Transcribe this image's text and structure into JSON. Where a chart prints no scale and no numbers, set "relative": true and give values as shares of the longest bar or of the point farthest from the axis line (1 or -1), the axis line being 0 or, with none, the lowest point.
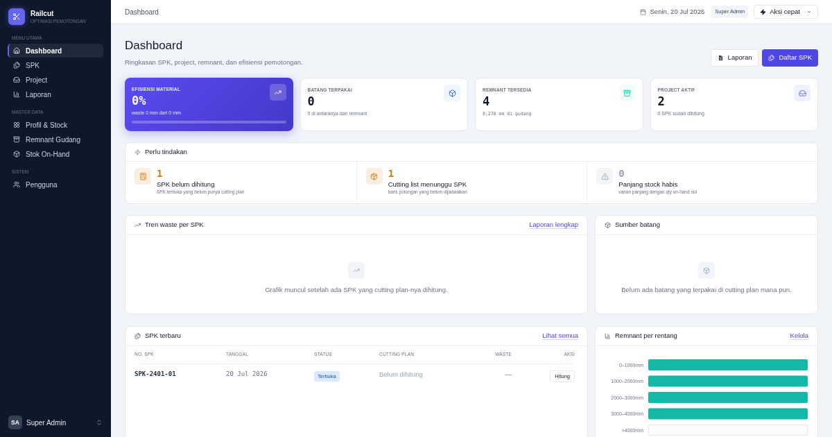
{
  "sidebar": {
    "brand": {
      "name": "Railcut",
      "tagline": "OPTIMASI PEMOTONGAN"
    },
    "sections": [
      {
        "title": "MENU UTAMA",
        "items": [
          {
            "label": "Dashboard",
            "selected": true
          },
          {
            "label": "SPK",
            "selected": false
          },
          {
            "label": "Project",
            "selected": false
          },
          {
            "label": "Laporan",
            "selected": false
          }
        ]
      },
      {
        "title": "MASTER DATA",
        "items": [
          {
            "label": "Profil & Stock",
            "selected": false
          },
          {
            "label": "Remnant Gudang",
            "selected": false
          },
          {
            "label": "Stok On-Hand",
            "selected": false
          }
        ]
      },
      {
        "title": "SISTEM",
        "items": [
          {
            "label": "Pengguna",
            "selected": false
          }
        ]
      }
    ],
    "user": {
      "initials": "SA",
      "name": "Super Admin"
    }
  },
  "topbar": {
    "breadcrumb": "Dashboard",
    "date": "Senin, 20 Jul 2026",
    "role_badge": "Super Admin",
    "quick_action": "Aksi cepat"
  },
  "page_header": {
    "title": "Dashboard",
    "subtitle": "Ringkasan SPK, project, remnant, dan efisiensi pemotongan.",
    "buttons": [
      {
        "label": "Laporan",
        "kind": "secondary"
      },
      {
        "label": "Daftar SPK",
        "kind": "primary"
      }
    ]
  },
  "stat_cards": [
    {
      "kind": "highlight",
      "label": "EFISIENSI MATERIAL",
      "value": "0%",
      "note": "waste 0 mm dari 0 mm"
    },
    {
      "kind": "plain",
      "label": "BATANG TERPAKAI",
      "value": "0",
      "note": "0 di antaranya dari remnant"
    },
    {
      "kind": "plain",
      "label": "REMNANT TERSEDIA",
      "value": "4",
      "note": "8,270 mm di gudang"
    },
    {
      "kind": "plain",
      "label": "PROJECT AKTIF",
      "value": "2",
      "note": "0 SPK sudah dihitung"
    }
  ],
  "action_panel": {
    "title": "Perlu tindakan",
    "items": [
      {
        "count": "1",
        "title": "SPK belum dihitung",
        "description": "SPK terbuka yang belum punya cutting plan",
        "color": "#d97706"
      },
      {
        "count": "1",
        "title": "Cutting list menunggu SPK",
        "description": "baris potongan yang belum dijadwalkan",
        "color": "#d97706"
      },
      {
        "count": "0",
        "title": "Panjang stock habis",
        "description": "varian panjang dengan qty on-hand nol",
        "color": "#94a3b8"
      }
    ]
  },
  "trend_panel": {
    "title": "Tren waste per SPK",
    "link": "Laporan lengkap",
    "empty_message": "Grafik muncul setelah ada SPK yang cutting plan-nya dihitung."
  },
  "source_panel": {
    "title": "Sumber batang",
    "empty_message": "Belum ada batang yang terpakai di cutting plan mana pun."
  },
  "recent_spk": {
    "title": "SPK terbaru",
    "link": "Lihat semua",
    "columns": [
      "NO. SPK",
      "TANGGAL",
      "STATUS",
      "CUTTING PLAN",
      "WASTE",
      "AKSI"
    ],
    "rows": [
      {
        "no_spk": "SPK-2401-01",
        "tanggal": "20 Jul 2026",
        "status": "Terbuka",
        "cutting_plan": "Belum dihitung",
        "waste": "—",
        "action": "Hitung"
      }
    ]
  },
  "remnant_panel": {
    "title": "Remnant per rentang",
    "link": "Kelola",
    "chart_data": {
      "type": "bar",
      "orientation": "horizontal",
      "relative": true,
      "categories": [
        "0–1000mm",
        "1000–2000mm",
        "2000–3000mm",
        "3000–4000mm",
        ">4000mm"
      ],
      "values": [
        1,
        1,
        1,
        1,
        0
      ]
    }
  }
}
